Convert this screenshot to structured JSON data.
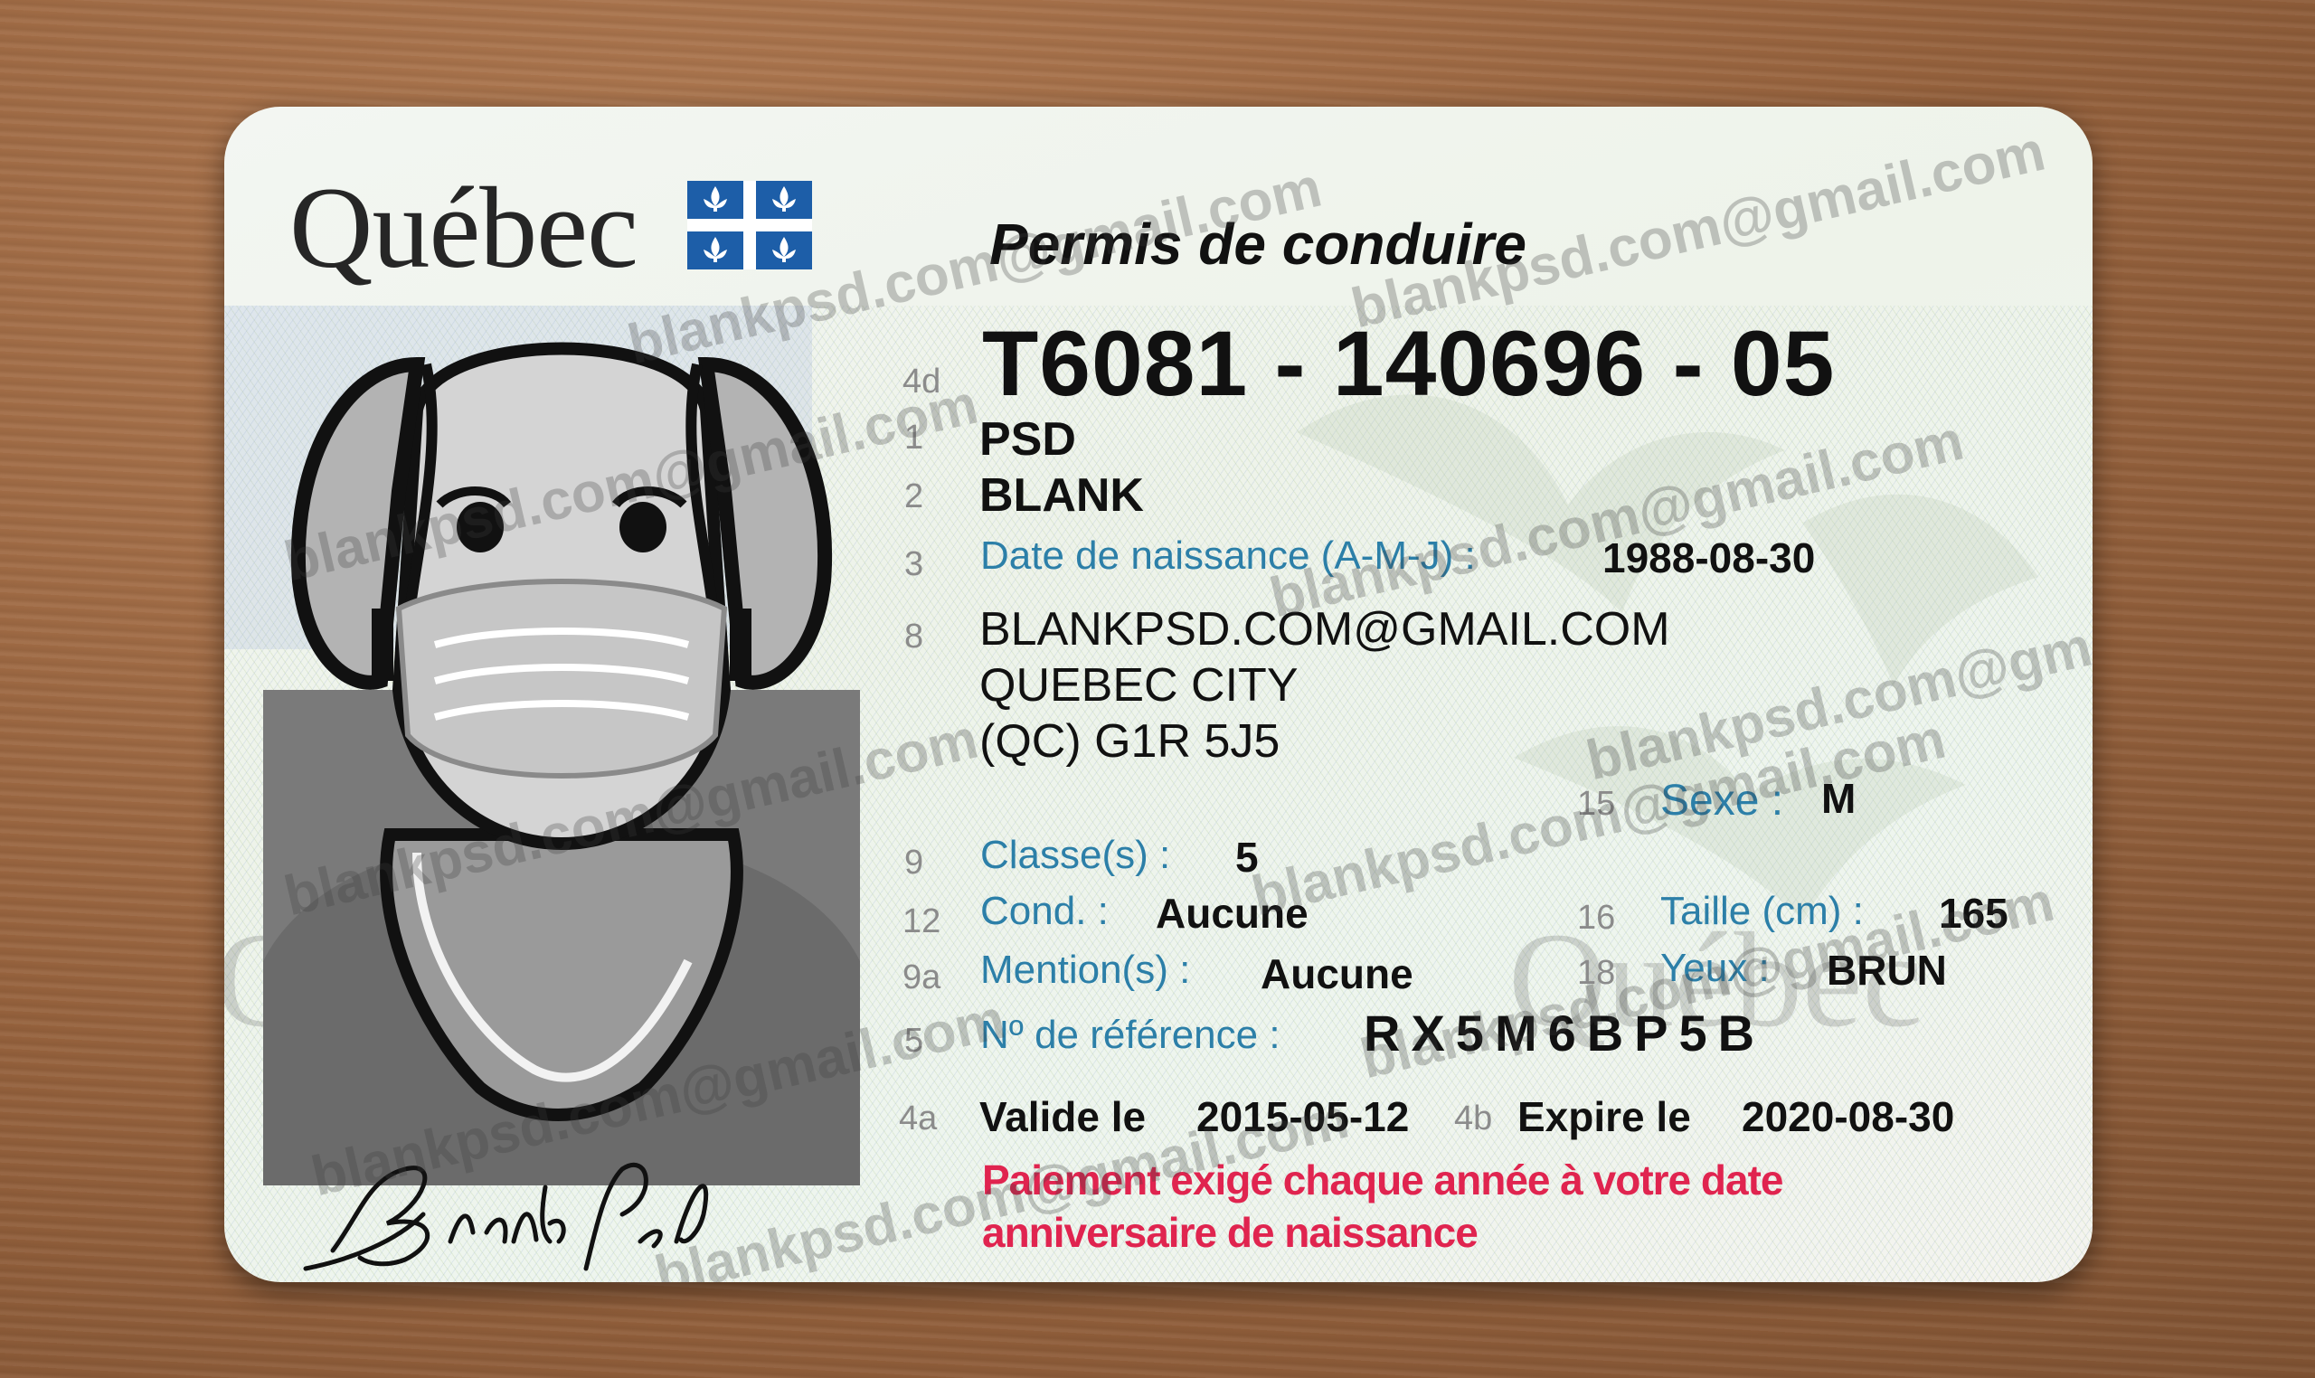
{
  "card": {
    "province": "Québec",
    "title": "Permis de conduire",
    "license_number": "T6081 - 140696 - 05",
    "field_numbers": {
      "license": "4d",
      "surname": "1",
      "given": "2",
      "dob": "3",
      "address": "8",
      "sex": "15",
      "classes": "9",
      "cond": "12",
      "height": "16",
      "mentions": "9a",
      "eyes": "18",
      "ref": "5",
      "valid": "4a",
      "expire": "4b"
    },
    "surname": "PSD",
    "given_name": "BLANK",
    "dob_label": "Date de naissance (A-M-J) :",
    "dob": "1988-08-30",
    "address_line1": "BLANKPSD.COM@GMAIL.COM",
    "address_line2": "QUEBEC CITY",
    "address_line3": "(QC) G1R 5J5",
    "sex_label": "Sexe :",
    "sex": "M",
    "classes_label": "Classe(s) :",
    "classes": "5",
    "cond_label": "Cond. :",
    "cond": "Aucune",
    "height_label": "Taille (cm) :",
    "height": "165",
    "mentions_label": "Mention(s) :",
    "mentions": "Aucune",
    "eyes_label": "Yeux :",
    "eyes": "BRUN",
    "ref_label": "Nº de référence :",
    "ref": "RX5M6BP5B",
    "valid_label": "Valide le",
    "valid": "2015-05-12",
    "expire_label": "Expire le",
    "expire": "2020-08-30",
    "notice_line1": "Paiement exigé chaque année à votre date",
    "notice_line2": "anniversaire de naissance",
    "signature": "Blank Psd",
    "watermark": "blankpsd.com@gmail.com",
    "ghost_text": "Québec"
  },
  "colors": {
    "label_blue": "#2c7fa8",
    "notice_red": "#e0244f",
    "flag_blue": "#1d5ea8"
  },
  "icons": [
    "quebec-flag-icon",
    "fleur-de-lis-icon"
  ]
}
